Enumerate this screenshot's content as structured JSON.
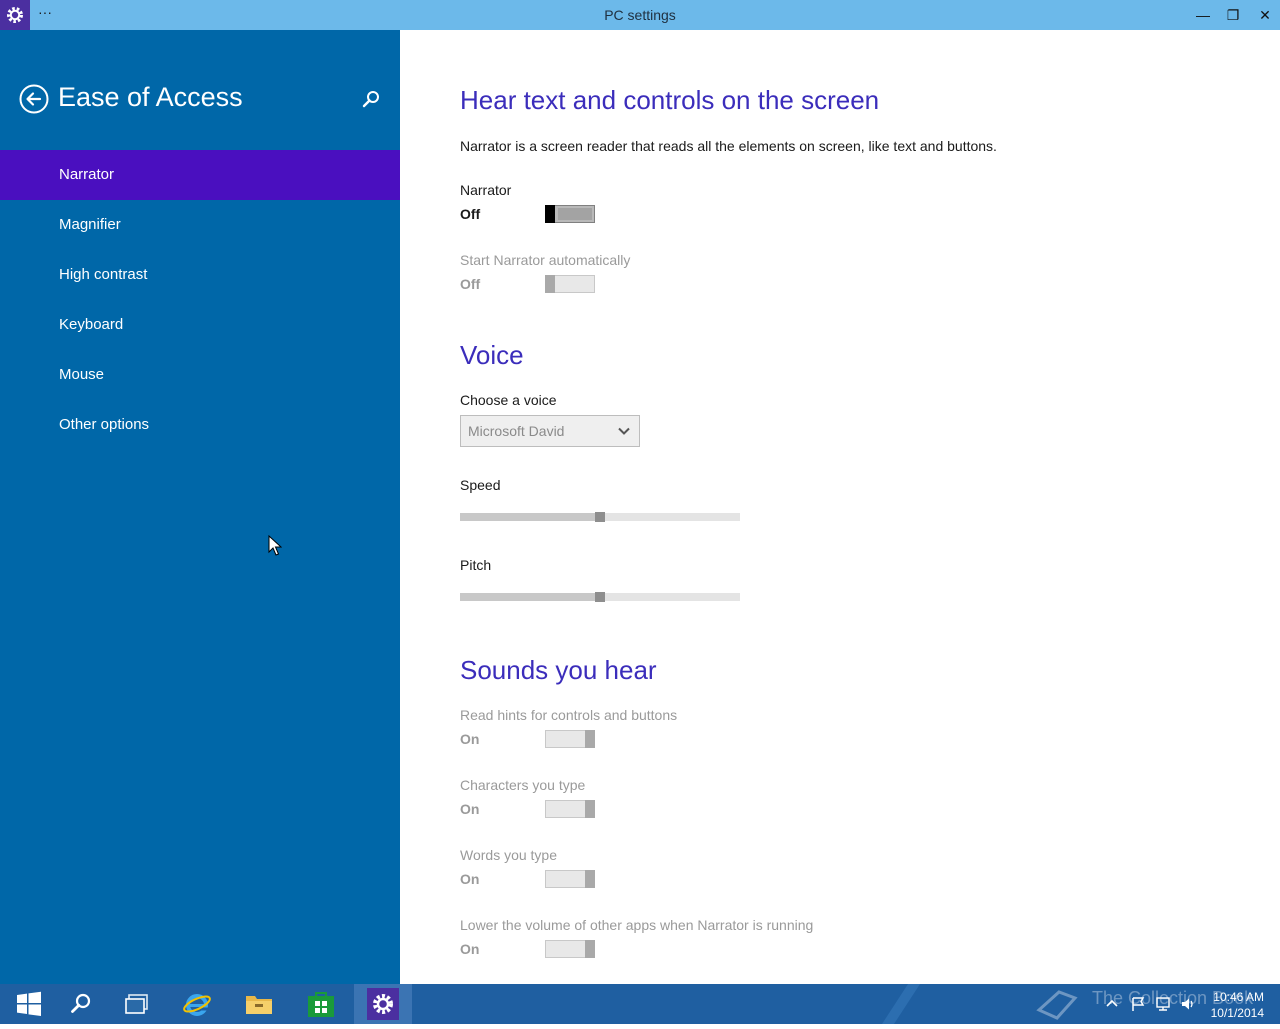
{
  "window": {
    "title": "PC settings",
    "menu_label": "···",
    "minimize_glyph": "—",
    "maximize_glyph": "❐",
    "close_glyph": "✕"
  },
  "sidebar": {
    "title": "Ease of Access",
    "items": [
      {
        "label": "Narrator",
        "selected": true
      },
      {
        "label": "Magnifier"
      },
      {
        "label": "High contrast"
      },
      {
        "label": "Keyboard"
      },
      {
        "label": "Mouse"
      },
      {
        "label": "Other options"
      }
    ]
  },
  "main": {
    "section1": {
      "heading": "Hear text and controls on the screen",
      "description": "Narrator is a screen reader that reads all the elements on screen, like text and buttons.",
      "narrator": {
        "label": "Narrator",
        "state": "Off"
      },
      "auto": {
        "label": "Start Narrator automatically",
        "state": "Off"
      }
    },
    "voice": {
      "heading": "Voice",
      "choose_label": "Choose a voice",
      "selected_voice": "Microsoft David",
      "speed_label": "Speed",
      "speed_level": 0.5,
      "pitch_label": "Pitch",
      "pitch_level": 0.5
    },
    "sounds": {
      "heading": "Sounds you hear",
      "items": [
        {
          "label": "Read hints for controls and buttons",
          "state": "On"
        },
        {
          "label": "Characters you type",
          "state": "On"
        },
        {
          "label": "Words you type",
          "state": "On"
        },
        {
          "label": "Lower the volume of other apps when Narrator is running",
          "state": "On"
        }
      ]
    }
  },
  "taskbar": {
    "time": "10:46 AM",
    "date": "10/1/2014",
    "watermark": "The Collection Book"
  },
  "colors": {
    "sidebar_bg": "#0067a8",
    "selected_item": "#4a0fbf",
    "heading": "#3b2dbb",
    "titlebar": "#6cb9ea",
    "taskbar": "#1f5fa1"
  }
}
